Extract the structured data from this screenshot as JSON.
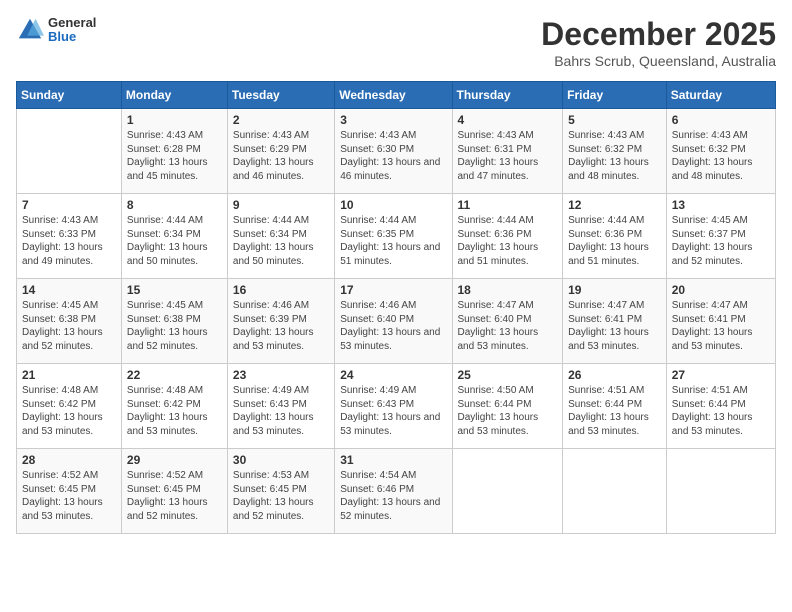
{
  "logo": {
    "general": "General",
    "blue": "Blue"
  },
  "title": "December 2025",
  "subtitle": "Bahrs Scrub, Queensland, Australia",
  "days_of_week": [
    "Sunday",
    "Monday",
    "Tuesday",
    "Wednesday",
    "Thursday",
    "Friday",
    "Saturday"
  ],
  "weeks": [
    [
      {
        "day": "",
        "sunrise": "",
        "sunset": "",
        "daylight": ""
      },
      {
        "day": "1",
        "sunrise": "Sunrise: 4:43 AM",
        "sunset": "Sunset: 6:28 PM",
        "daylight": "Daylight: 13 hours and 45 minutes."
      },
      {
        "day": "2",
        "sunrise": "Sunrise: 4:43 AM",
        "sunset": "Sunset: 6:29 PM",
        "daylight": "Daylight: 13 hours and 46 minutes."
      },
      {
        "day": "3",
        "sunrise": "Sunrise: 4:43 AM",
        "sunset": "Sunset: 6:30 PM",
        "daylight": "Daylight: 13 hours and 46 minutes."
      },
      {
        "day": "4",
        "sunrise": "Sunrise: 4:43 AM",
        "sunset": "Sunset: 6:31 PM",
        "daylight": "Daylight: 13 hours and 47 minutes."
      },
      {
        "day": "5",
        "sunrise": "Sunrise: 4:43 AM",
        "sunset": "Sunset: 6:32 PM",
        "daylight": "Daylight: 13 hours and 48 minutes."
      },
      {
        "day": "6",
        "sunrise": "Sunrise: 4:43 AM",
        "sunset": "Sunset: 6:32 PM",
        "daylight": "Daylight: 13 hours and 48 minutes."
      }
    ],
    [
      {
        "day": "7",
        "sunrise": "Sunrise: 4:43 AM",
        "sunset": "Sunset: 6:33 PM",
        "daylight": "Daylight: 13 hours and 49 minutes."
      },
      {
        "day": "8",
        "sunrise": "Sunrise: 4:44 AM",
        "sunset": "Sunset: 6:34 PM",
        "daylight": "Daylight: 13 hours and 50 minutes."
      },
      {
        "day": "9",
        "sunrise": "Sunrise: 4:44 AM",
        "sunset": "Sunset: 6:34 PM",
        "daylight": "Daylight: 13 hours and 50 minutes."
      },
      {
        "day": "10",
        "sunrise": "Sunrise: 4:44 AM",
        "sunset": "Sunset: 6:35 PM",
        "daylight": "Daylight: 13 hours and 51 minutes."
      },
      {
        "day": "11",
        "sunrise": "Sunrise: 4:44 AM",
        "sunset": "Sunset: 6:36 PM",
        "daylight": "Daylight: 13 hours and 51 minutes."
      },
      {
        "day": "12",
        "sunrise": "Sunrise: 4:44 AM",
        "sunset": "Sunset: 6:36 PM",
        "daylight": "Daylight: 13 hours and 51 minutes."
      },
      {
        "day": "13",
        "sunrise": "Sunrise: 4:45 AM",
        "sunset": "Sunset: 6:37 PM",
        "daylight": "Daylight: 13 hours and 52 minutes."
      }
    ],
    [
      {
        "day": "14",
        "sunrise": "Sunrise: 4:45 AM",
        "sunset": "Sunset: 6:38 PM",
        "daylight": "Daylight: 13 hours and 52 minutes."
      },
      {
        "day": "15",
        "sunrise": "Sunrise: 4:45 AM",
        "sunset": "Sunset: 6:38 PM",
        "daylight": "Daylight: 13 hours and 52 minutes."
      },
      {
        "day": "16",
        "sunrise": "Sunrise: 4:46 AM",
        "sunset": "Sunset: 6:39 PM",
        "daylight": "Daylight: 13 hours and 53 minutes."
      },
      {
        "day": "17",
        "sunrise": "Sunrise: 4:46 AM",
        "sunset": "Sunset: 6:40 PM",
        "daylight": "Daylight: 13 hours and 53 minutes."
      },
      {
        "day": "18",
        "sunrise": "Sunrise: 4:47 AM",
        "sunset": "Sunset: 6:40 PM",
        "daylight": "Daylight: 13 hours and 53 minutes."
      },
      {
        "day": "19",
        "sunrise": "Sunrise: 4:47 AM",
        "sunset": "Sunset: 6:41 PM",
        "daylight": "Daylight: 13 hours and 53 minutes."
      },
      {
        "day": "20",
        "sunrise": "Sunrise: 4:47 AM",
        "sunset": "Sunset: 6:41 PM",
        "daylight": "Daylight: 13 hours and 53 minutes."
      }
    ],
    [
      {
        "day": "21",
        "sunrise": "Sunrise: 4:48 AM",
        "sunset": "Sunset: 6:42 PM",
        "daylight": "Daylight: 13 hours and 53 minutes."
      },
      {
        "day": "22",
        "sunrise": "Sunrise: 4:48 AM",
        "sunset": "Sunset: 6:42 PM",
        "daylight": "Daylight: 13 hours and 53 minutes."
      },
      {
        "day": "23",
        "sunrise": "Sunrise: 4:49 AM",
        "sunset": "Sunset: 6:43 PM",
        "daylight": "Daylight: 13 hours and 53 minutes."
      },
      {
        "day": "24",
        "sunrise": "Sunrise: 4:49 AM",
        "sunset": "Sunset: 6:43 PM",
        "daylight": "Daylight: 13 hours and 53 minutes."
      },
      {
        "day": "25",
        "sunrise": "Sunrise: 4:50 AM",
        "sunset": "Sunset: 6:44 PM",
        "daylight": "Daylight: 13 hours and 53 minutes."
      },
      {
        "day": "26",
        "sunrise": "Sunrise: 4:51 AM",
        "sunset": "Sunset: 6:44 PM",
        "daylight": "Daylight: 13 hours and 53 minutes."
      },
      {
        "day": "27",
        "sunrise": "Sunrise: 4:51 AM",
        "sunset": "Sunset: 6:44 PM",
        "daylight": "Daylight: 13 hours and 53 minutes."
      }
    ],
    [
      {
        "day": "28",
        "sunrise": "Sunrise: 4:52 AM",
        "sunset": "Sunset: 6:45 PM",
        "daylight": "Daylight: 13 hours and 53 minutes."
      },
      {
        "day": "29",
        "sunrise": "Sunrise: 4:52 AM",
        "sunset": "Sunset: 6:45 PM",
        "daylight": "Daylight: 13 hours and 52 minutes."
      },
      {
        "day": "30",
        "sunrise": "Sunrise: 4:53 AM",
        "sunset": "Sunset: 6:45 PM",
        "daylight": "Daylight: 13 hours and 52 minutes."
      },
      {
        "day": "31",
        "sunrise": "Sunrise: 4:54 AM",
        "sunset": "Sunset: 6:46 PM",
        "daylight": "Daylight: 13 hours and 52 minutes."
      },
      {
        "day": "",
        "sunrise": "",
        "sunset": "",
        "daylight": ""
      },
      {
        "day": "",
        "sunrise": "",
        "sunset": "",
        "daylight": ""
      },
      {
        "day": "",
        "sunrise": "",
        "sunset": "",
        "daylight": ""
      }
    ]
  ]
}
